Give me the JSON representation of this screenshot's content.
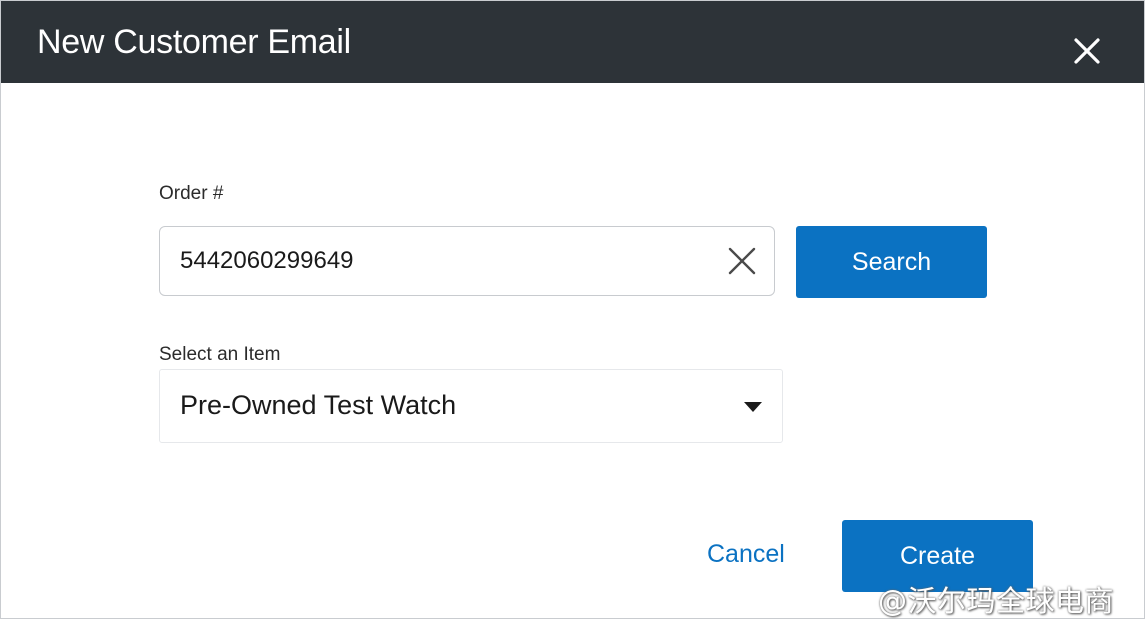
{
  "dialog": {
    "title": "New Customer Email",
    "close_icon": "close-icon"
  },
  "order": {
    "label": "Order #",
    "value": "5442060299649",
    "clear_icon": "clear-icon",
    "search_label": "Search"
  },
  "item": {
    "label": "Select an Item",
    "selected": "Pre-Owned Test Watch",
    "caret_icon": "caret-down-icon"
  },
  "footer": {
    "cancel_label": "Cancel",
    "create_label": "Create"
  },
  "watermark": {
    "text": "@沃尔玛全球电商"
  },
  "colors": {
    "header_bg": "#2d3338",
    "accent": "#0b72c2"
  }
}
